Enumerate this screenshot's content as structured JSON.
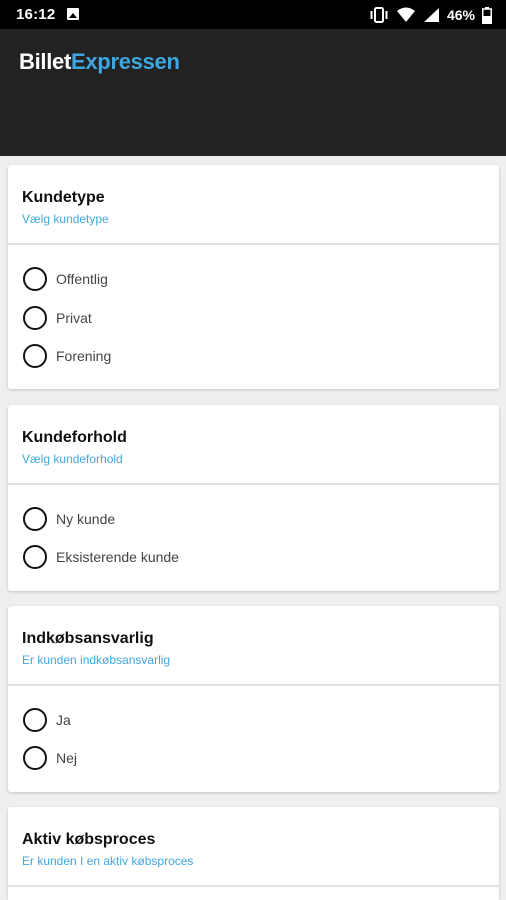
{
  "status_bar": {
    "time": "16:12",
    "battery": "46%",
    "icons": [
      "image-icon",
      "vibrate-icon",
      "wifi-icon",
      "signal-icon",
      "battery-icon"
    ]
  },
  "app_bar": {
    "logo_part1": "Billet",
    "logo_part2": "Expressen",
    "colors": {
      "background": "#222222",
      "accent": "#3fa7e0"
    }
  },
  "sections": [
    {
      "title": "Kundetype",
      "subtitle": "Vælg kundetype",
      "options": [
        "Offentlig",
        "Privat",
        "Forening"
      ]
    },
    {
      "title": "Kundeforhold",
      "subtitle": "Vælg kundeforhold",
      "options": [
        "Ny kunde",
        "Eksisterende kunde"
      ]
    },
    {
      "title": "Indkøbsansvarlig",
      "subtitle": "Er kunden indkøbsansvarlig",
      "options": [
        "Ja",
        "Nej"
      ]
    },
    {
      "title": "Aktiv købsproces",
      "subtitle": "Er kunden I en aktiv købsproces",
      "options": []
    }
  ]
}
